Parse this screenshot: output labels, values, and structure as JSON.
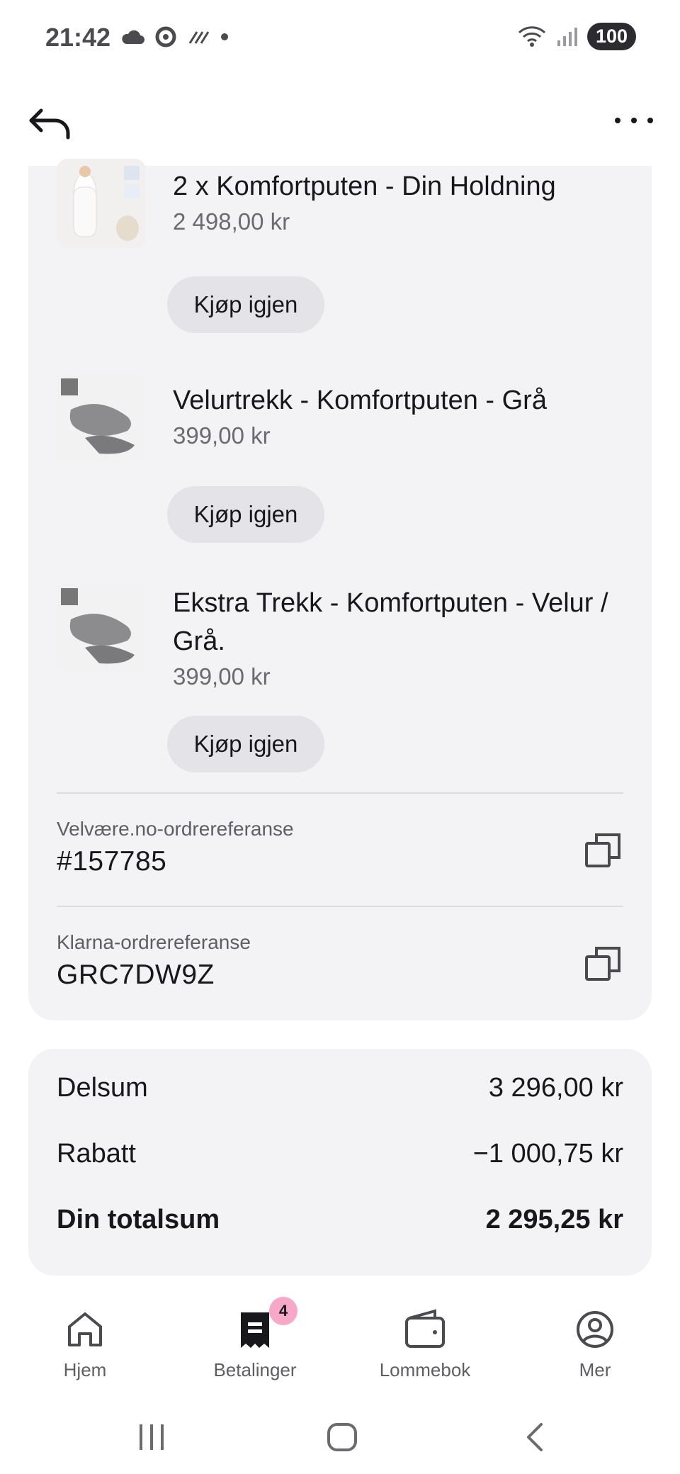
{
  "status_bar": {
    "time": "21:42",
    "battery": "100",
    "icons": [
      "cloud-icon",
      "sync-icon",
      "data-saver-icon",
      "dot-icon",
      "wifi-icon",
      "signal-icon"
    ]
  },
  "header": {
    "back_icon": "back-arrow-icon",
    "more_icon": "more-horizontal-icon"
  },
  "items": [
    {
      "name": "2 x Komfortputen - Din Holdning",
      "price": "2 498,00 kr",
      "action": "Kjøp igjen"
    },
    {
      "name": "Velurtrekk - Komfortputen - Grå",
      "price": "399,00 kr",
      "action": "Kjøp igjen"
    },
    {
      "name": "Ekstra Trekk - Komfortputen - Velur / Grå.",
      "price": "399,00 kr",
      "action": "Kjøp igjen"
    }
  ],
  "references": [
    {
      "label": "Velvære.no-ordrereferanse",
      "value": "#157785"
    },
    {
      "label": "Klarna-ordrereferanse",
      "value": "GRC7DW9Z"
    }
  ],
  "totals": {
    "subtotal_label": "Delsum",
    "subtotal": "3 296,00 kr",
    "discount_label": "Rabatt",
    "discount": "−1 000,75 kr",
    "total_label": "Din totalsum",
    "total": "2 295,25 kr"
  },
  "nav": {
    "items": [
      {
        "label": "Hjem",
        "icon": "home-icon"
      },
      {
        "label": "Betalinger",
        "icon": "receipt-icon",
        "badge": "4"
      },
      {
        "label": "Lommebok",
        "icon": "wallet-icon"
      },
      {
        "label": "Mer",
        "icon": "profile-icon"
      }
    ]
  },
  "colors": {
    "card_bg": "#f3f3f6",
    "button_bg": "#e3e3e8",
    "badge_bg": "#f7a8c8",
    "text": "#17171c"
  }
}
